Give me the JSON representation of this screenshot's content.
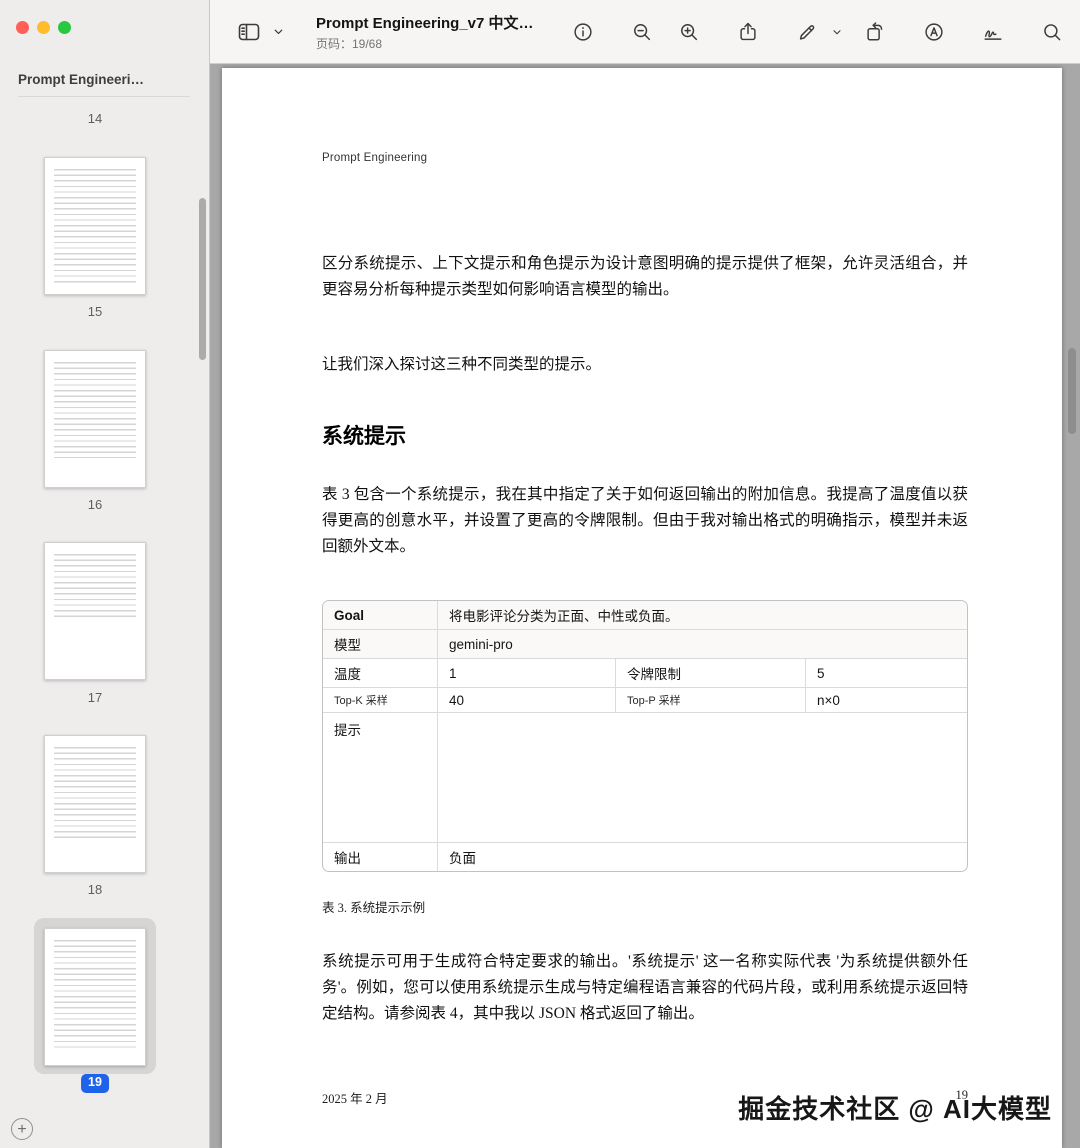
{
  "window": {
    "sidebar_title": "Prompt Engineeri…",
    "title": "Prompt Engineering_v7 中文…",
    "page_indicator": "页码：19/68"
  },
  "sidebar": {
    "thumbnails": [
      {
        "page": "14"
      },
      {
        "page": "15"
      },
      {
        "page": "16"
      },
      {
        "page": "17"
      },
      {
        "page": "18"
      },
      {
        "page": "19"
      }
    ],
    "selected_page": "19",
    "add_label": "+"
  },
  "toolbar": {
    "icons": {
      "sidebar_toggle": "sidebar-panel-icon",
      "info": "info-icon",
      "zoom_out": "zoom-out-icon",
      "zoom_in": "zoom-in-icon",
      "share": "share-icon",
      "markup": "markup-pen-icon",
      "rotate": "rotate-icon",
      "annotate": "circle-a-icon",
      "signature": "signature-icon",
      "search": "search-icon"
    }
  },
  "doc": {
    "running_header": "Prompt Engineering",
    "para1": "区分系统提示、上下文提示和角色提示为设计意图明确的提示提供了框架，允许灵活组合，并更容易分析每种提示类型如何影响语言模型的输出。",
    "para2": "让我们深入探讨这三种不同类型的提示。",
    "heading": "系统提示",
    "para3": "表 3 包含一个系统提示，我在其中指定了关于如何返回输出的附加信息。我提高了温度值以获得更高的创意水平，并设置了更高的令牌限制。但由于我对输出格式的明确指示，模型并未返回额外文本。",
    "table": {
      "goal_label": "Goal",
      "goal_value": "将电影评论分类为正面、中性或负面。",
      "model_label": "模型",
      "model_value": "gemini-pro",
      "temp_label": "温度",
      "temp_value": "1",
      "token_label": "令牌限制",
      "token_value": "5",
      "topk_label": "Top-K 采样",
      "topk_value": "40",
      "topp_label": "Top-P 采样",
      "topp_value": "n×0",
      "prompt_label": "提示",
      "prompt_value": "",
      "output_label": "输出",
      "output_value": "负面",
      "caption": "表 3. 系统提示示例"
    },
    "para4": "系统提示可用于生成符合特定要求的输出。'系统提示' 这一名称实际代表 '为系统提供额外任务'。例如，您可以使用系统提示生成与特定编程语言兼容的代码片段，或利用系统提示返回特定结构。请参阅表 4，其中我以 JSON 格式返回了输出。",
    "footer_date": "2025 年 2 月",
    "footer_page": "19"
  },
  "watermark": "掘金技术社区 @ AI大模型",
  "colors": {
    "accent_blue": "#1e63e9",
    "content_bg": "#a8a8a8"
  }
}
